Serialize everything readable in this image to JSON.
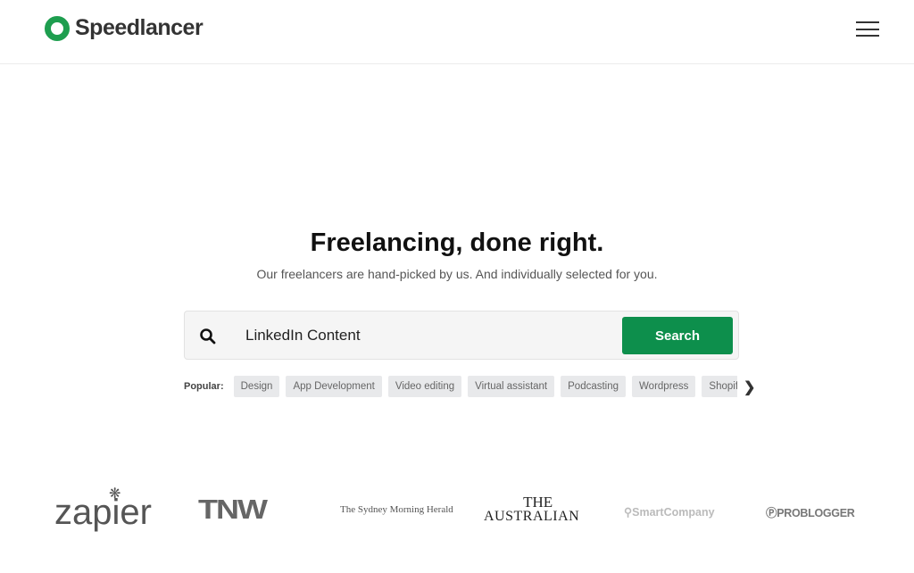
{
  "header": {
    "brand": "Speedlancer",
    "brand_color": "#1e9e4f",
    "menu_icon": "hamburger-icon"
  },
  "hero": {
    "title": "Freelancing, done right.",
    "subtitle": "Our freelancers are hand-picked by us. And individually selected for you."
  },
  "search": {
    "value": "LinkedIn Content",
    "button_label": "Search",
    "button_color": "#0d8f4c",
    "icon": "search-icon"
  },
  "popular": {
    "label": "Popular:",
    "tags": [
      "Design",
      "App Development",
      "Video editing",
      "Virtual assistant",
      "Podcasting",
      "Wordpress",
      "Shopify"
    ]
  },
  "press_logos": {
    "zapier": "zapier",
    "tnw": "TNW",
    "smh": "The Sydney Morning Herald",
    "australian_line1": "THE",
    "australian_line2": "AUSTRALIAN",
    "smartcompany": "SmartCompany",
    "problogger": "PROBLOGGER"
  }
}
